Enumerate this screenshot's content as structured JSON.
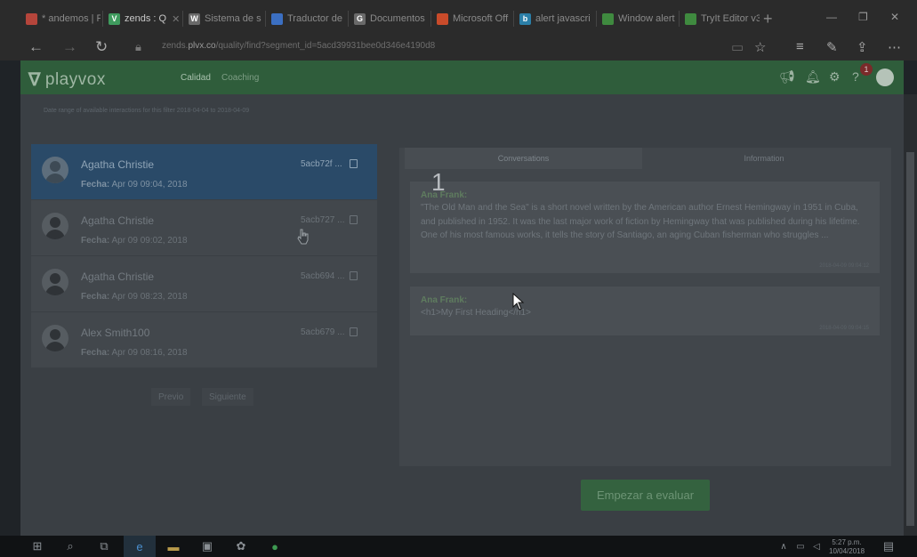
{
  "browser": {
    "tabs": [
      {
        "label": "* andemos | Pl",
        "icon": "red-app-icon",
        "color": "#b5453b"
      },
      {
        "label": "zends : Q",
        "icon": "playvox-icon",
        "color": "#3f9b5e",
        "active": true
      },
      {
        "label": "Sistema de s",
        "icon": "wikipedia-icon",
        "color": "#6a6a6a"
      },
      {
        "label": "Traductor de",
        "icon": "translate-icon",
        "color": "#3b6fc2"
      },
      {
        "label": "Documentos",
        "icon": "google-icon",
        "color": "#6a6a6a"
      },
      {
        "label": "Microsoft Off",
        "icon": "microsoft-icon",
        "color": "#c94b2a"
      },
      {
        "label": "alert javascri",
        "icon": "bing-icon",
        "color": "#2b7fa8"
      },
      {
        "label": "Window alert",
        "icon": "w3schools-icon",
        "color": "#3f8a3f"
      },
      {
        "label": "TryIt Editor v3",
        "icon": "w3schools-icon",
        "color": "#3f8a3f"
      }
    ],
    "url_prefix": "zends.",
    "url_domain": "plvx.co",
    "url_path": "/quality/find?segment_id=5acd39931bee0d346e4190d8"
  },
  "app": {
    "logo_text": "playvox",
    "nav": [
      {
        "label": "Calidad",
        "active": true
      },
      {
        "label": "Coaching",
        "active": false
      }
    ],
    "notification_count": "1"
  },
  "page": {
    "date_note": "Date range of available interactions for this filter 2018-04-04 to 2018-04-09",
    "conversations": [
      {
        "name": "Agatha Christie",
        "date_label": "Fecha:",
        "date": "Apr 09 09:04, 2018",
        "id": "5acb72f ...",
        "selected": true
      },
      {
        "name": "Agatha Christie",
        "date_label": "Fecha:",
        "date": "Apr 09 09:02, 2018",
        "id": "5acb727 ...",
        "selected": false
      },
      {
        "name": "Agatha Christie",
        "date_label": "Fecha:",
        "date": "Apr 09 08:23, 2018",
        "id": "5acb694 ...",
        "selected": false
      },
      {
        "name": "Alex Smith100",
        "date_label": "Fecha:",
        "date": "Apr 09 08:16, 2018",
        "id": "5acb679 ...",
        "selected": false
      }
    ],
    "pager": {
      "prev": "Previo",
      "next": "Siguiente"
    },
    "tabs": {
      "conversations": "Conversations",
      "information": "Information"
    },
    "messages": [
      {
        "author": "Ana Frank:",
        "text": "\"The Old Man and the Sea\" is a short novel written by the American author Ernest Hemingway in 1951 in Cuba, and published in 1952. It was the last major work of fiction by Hemingway that was published during his lifetime. One of his most famous works, it tells the story of Santiago, an aging Cuban fisherman who struggles ...",
        "time": "2018-04-09 09:04:12"
      },
      {
        "author": "Ana Frank:",
        "text": "<h1>My First Heading</h1>",
        "time": "2018-04-09 09:04:15"
      }
    ],
    "cursor_label": "1",
    "start_button": "Empezar a evaluar"
  },
  "taskbar": {
    "time": "5:27 p.m.",
    "date": "10/04/2018"
  }
}
